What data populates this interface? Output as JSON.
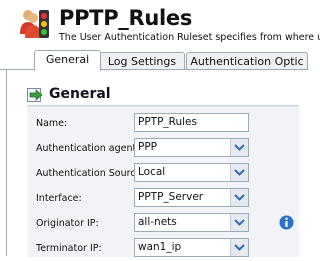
{
  "header": {
    "title": "PPTP_Rules",
    "subtitle": "The User Authentication Ruleset specifies from where us"
  },
  "tabs": [
    {
      "label": "General",
      "active": true
    },
    {
      "label": "Log Settings",
      "active": false
    },
    {
      "label": "Authentication Optic",
      "active": false
    }
  ],
  "section": {
    "title": "General"
  },
  "form": {
    "name": {
      "label": "Name:",
      "value": "PPTP_Rules"
    },
    "auth_agent": {
      "label": "Authentication agent:",
      "value": "PPP"
    },
    "auth_source": {
      "label": "Authentication Source:",
      "value": "Local"
    },
    "interface": {
      "label": "Interface:",
      "value": "PPTP_Server"
    },
    "originator_ip": {
      "label": "Originator IP:",
      "value": "all-nets"
    },
    "terminator_ip": {
      "label": "Terminator IP:",
      "value": "wan1_ip"
    }
  },
  "colors": {
    "accent": "#2f6db5",
    "info": "#2a72c8",
    "section_icon": "#3a9b3a"
  },
  "icons": [
    "users-traffic-icon",
    "arrow-right-icon",
    "chevron-down-icon",
    "info-icon"
  ]
}
